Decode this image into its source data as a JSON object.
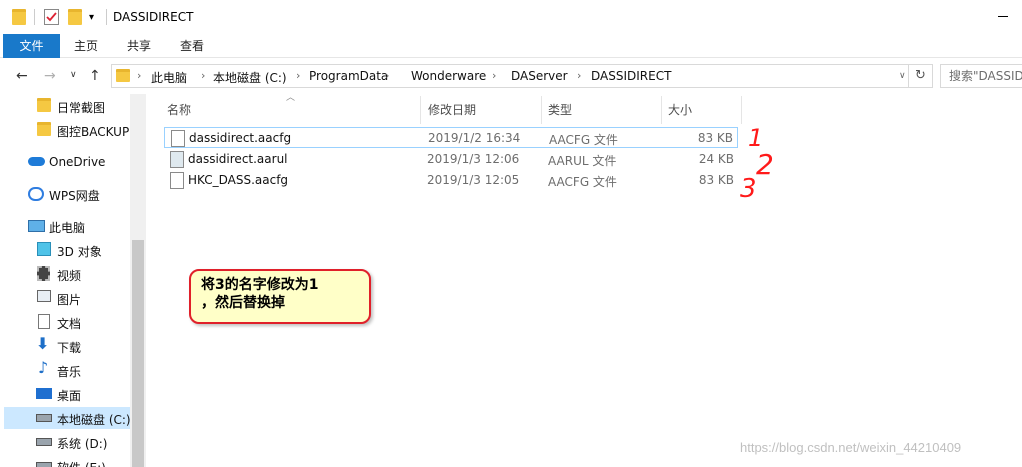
{
  "window": {
    "title": "DASSIDIRECT"
  },
  "ribbon": {
    "tabs": [
      "文件",
      "主页",
      "共享",
      "查看"
    ]
  },
  "address": {
    "crumbs": [
      "此电脑",
      "本地磁盘 (C:)",
      "ProgramData",
      "Wonderware",
      "DAServer",
      "DASSIDIRECT"
    ],
    "search_placeholder": "搜索\"DASSIDI"
  },
  "navpane": {
    "items": [
      {
        "label": "日常截图",
        "icon": "folder-icon"
      },
      {
        "label": "图控BACKUP",
        "icon": "folder-icon"
      },
      {
        "label": "OneDrive",
        "icon": "cloud-icon"
      },
      {
        "label": "WPS网盘",
        "icon": "wps-cloud-icon"
      },
      {
        "label": "此电脑",
        "icon": "computer-icon"
      },
      {
        "label": "3D 对象",
        "icon": "cube-icon"
      },
      {
        "label": "视频",
        "icon": "video-icon"
      },
      {
        "label": "图片",
        "icon": "picture-icon"
      },
      {
        "label": "文档",
        "icon": "document-icon"
      },
      {
        "label": "下载",
        "icon": "download-icon"
      },
      {
        "label": "音乐",
        "icon": "music-icon"
      },
      {
        "label": "桌面",
        "icon": "desktop-icon"
      },
      {
        "label": "本地磁盘 (C:)",
        "icon": "drive-icon",
        "selected": true
      },
      {
        "label": "系统 (D:)",
        "icon": "drive-icon"
      },
      {
        "label": "软件 (E:)",
        "icon": "drive-icon"
      }
    ]
  },
  "columns": {
    "name": "名称",
    "date": "修改日期",
    "type": "类型",
    "size": "大小"
  },
  "files": [
    {
      "name": "dassidirect.aacfg",
      "date": "2019/1/2 16:34",
      "type": "AACFG 文件",
      "size": "83 KB"
    },
    {
      "name": "dassidirect.aarul",
      "date": "2019/1/3 12:06",
      "type": "AARUL 文件",
      "size": "24 KB"
    },
    {
      "name": "HKC_DASS.aacfg",
      "date": "2019/1/3 12:05",
      "type": "AACFG 文件",
      "size": "83 KB"
    }
  ],
  "annotation": {
    "line1": "将3的名字修改为1",
    "line2": "，然后替换掉",
    "marks": [
      "1",
      "2",
      "3"
    ]
  },
  "watermark": "https://blog.csdn.net/weixin_44210409",
  "colors": {
    "file_tab": "#1979ca",
    "selection": "#cce8ff",
    "callout_border": "#e0202a",
    "callout_fill": "#ffffc8",
    "handwriting": "#ff1a1a"
  }
}
